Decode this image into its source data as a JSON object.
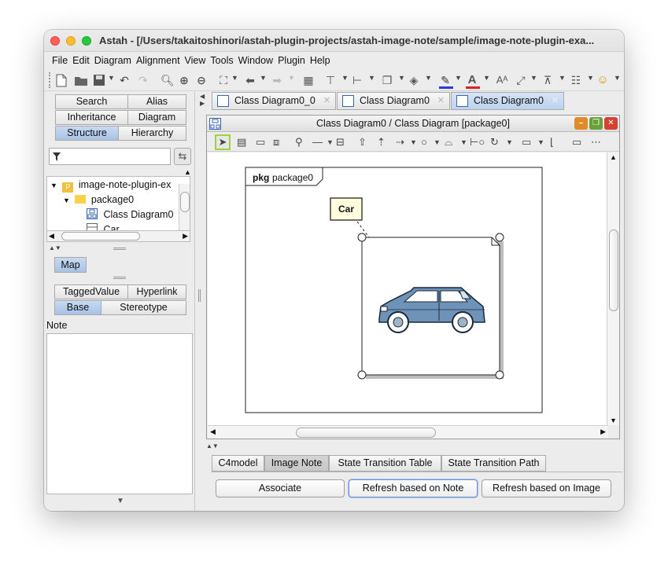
{
  "window": {
    "title": "Astah - [/Users/takaitoshinori/astah-plugin-projects/astah-image-note/sample/image-note-plugin-exa..."
  },
  "menu": [
    "File",
    "Edit",
    "Diagram",
    "Alignment",
    "View",
    "Tools",
    "Window",
    "Plugin",
    "Help"
  ],
  "left_tabs_row1": [
    "Search",
    "Alias"
  ],
  "left_tabs_row2": [
    "Inheritance",
    "Diagram"
  ],
  "left_tabs_row3": [
    "Structure",
    "Hierarchy"
  ],
  "tree": {
    "root": "image-note-plugin-ex",
    "package": "package0",
    "diagram": "Class Diagram0",
    "cls": "Car"
  },
  "map_tab": "Map",
  "prop_tabs_row1": [
    "TaggedValue",
    "Hyperlink"
  ],
  "prop_tabs_row2": [
    "Base",
    "Stereotype"
  ],
  "note_label": "Note",
  "doc_tabs": [
    "Class Diagram0_0",
    "Class Diagram0",
    "Class Diagram0"
  ],
  "inner_title": "Class Diagram0 / Class Diagram [package0]",
  "diagram": {
    "pkg_keyword": "pkg",
    "pkg_name": "package0",
    "class_name": "Car"
  },
  "bottom_tabs": [
    "C4model",
    "Image Note",
    "State Transition Table",
    "State Transition Path"
  ],
  "buttons": {
    "associate": "Associate",
    "refresh_note": "Refresh based on Note",
    "refresh_image": "Refresh based on Image"
  }
}
